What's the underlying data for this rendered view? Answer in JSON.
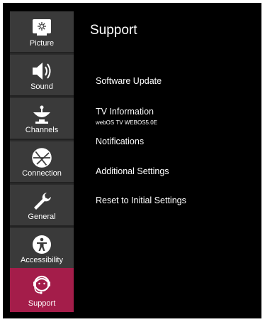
{
  "sidebar": {
    "items": [
      {
        "label": "Picture",
        "icon": "picture-icon"
      },
      {
        "label": "Sound",
        "icon": "speaker-icon"
      },
      {
        "label": "Channels",
        "icon": "satellite-icon"
      },
      {
        "label": "Connection",
        "icon": "globe-icon"
      },
      {
        "label": "General",
        "icon": "wrench-icon"
      },
      {
        "label": "Accessibility",
        "icon": "accessibility-icon"
      },
      {
        "label": "Support",
        "icon": "headset-icon",
        "active": true
      }
    ]
  },
  "main": {
    "title": "Support",
    "menu": [
      {
        "label": "Software Update"
      },
      {
        "label": "TV Information",
        "sublabel": "webOS TV WEBOS5.0E"
      },
      {
        "label": "Notifications"
      },
      {
        "label": "Additional Settings"
      },
      {
        "label": "Reset to Initial Settings"
      }
    ]
  },
  "colors": {
    "background": "#000000",
    "sidebar_item": "#3a3a3a",
    "active_item": "#a41d4a",
    "text": "#ffffff"
  }
}
